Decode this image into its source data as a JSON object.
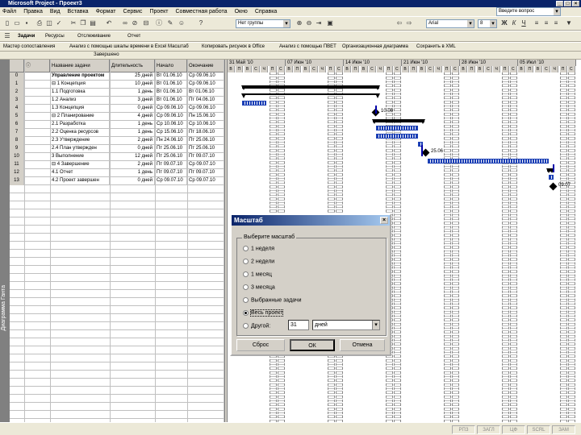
{
  "window": {
    "title": "Microsoft Project - Проект3"
  },
  "menu": [
    "Файл",
    "Правка",
    "Вид",
    "Вставка",
    "Формат",
    "Сервис",
    "Проект",
    "Совместная работа",
    "Окно",
    "Справка"
  ],
  "toolbar": {
    "group_combo": "Нет группы",
    "font_combo": "Arial",
    "size_combo": "8",
    "tasks_label": "Задачи",
    "resources_label": "Ресурсы",
    "track_label": "Отслеживание",
    "report_label": "Отчет",
    "help_box": "Введите вопрос"
  },
  "toolbar3": [
    "Мастер сопоставления",
    "Анализ с помощью шкалы времени в Excel",
    "Масштаб",
    "Копировать рисунок в Office",
    "Анализ с помощью ПВЕТ",
    "Организационная диаграмма",
    "Сохранить в XML"
  ],
  "fieldbar": {
    "value": "Завершено"
  },
  "viewbar": {
    "label": "Диаграмма Ганта"
  },
  "table": {
    "headers": [
      "",
      "",
      "Название задачи",
      "Длительность",
      "Начало",
      "Окончание"
    ],
    "rows": [
      {
        "id": "0",
        "name": "Управление проектом",
        "duration": "25 дней",
        "start": "Вт 01.06.10",
        "finish": "Ср 09.06.10"
      },
      {
        "id": "1",
        "name": "⊟ 1 Концепция",
        "duration": "10 дней",
        "start": "Вт 01.06.10",
        "finish": "Ср 09.06.10"
      },
      {
        "id": "2",
        "name": "1.1 Подготовка",
        "duration": "1 день",
        "start": "Вт 01.06.10",
        "finish": "Вт 01.06.10"
      },
      {
        "id": "3",
        "name": "1.2 Анализ",
        "duration": "3 дней",
        "start": "Вт 01.06.10",
        "finish": "Пт 04.06.10"
      },
      {
        "id": "4",
        "name": "1.3 Концепция",
        "duration": "0 дней",
        "start": "Ср 09.06.10",
        "finish": "Ср 09.06.10"
      },
      {
        "id": "5",
        "name": "⊟ 2 Планирование",
        "duration": "4 дней",
        "start": "Ср 09.06.10",
        "finish": "Пн 15.06.10"
      },
      {
        "id": "6",
        "name": "2.1 Разработка",
        "duration": "1 день",
        "start": "Ср 10.06.10",
        "finish": "Ср 10.06.10"
      },
      {
        "id": "7",
        "name": "2.2 Оценка ресурсов",
        "duration": "1 день",
        "start": "Ср 15.06.10",
        "finish": "Пт 18.06.10"
      },
      {
        "id": "8",
        "name": "2.3 Утверждение",
        "duration": "2 дней",
        "start": "Пн 24.06.10",
        "finish": "Пт 25.06.10"
      },
      {
        "id": "9",
        "name": "2.4 План утвержден",
        "duration": "0 дней",
        "start": "Пт 25.06.10",
        "finish": "Пт 25.06.10"
      },
      {
        "id": "10",
        "name": "3 Выполнение",
        "duration": "12 дней",
        "start": "Пт 25.06.10",
        "finish": "Пт 09.07.10"
      },
      {
        "id": "11",
        "name": "⊟ 4 Завершение",
        "duration": "2 дней",
        "start": "Пт 09.07.10",
        "finish": "Ср 09.07.10"
      },
      {
        "id": "12",
        "name": "4.1 Отчет",
        "duration": "1 день",
        "start": "Пт 09.07.10",
        "finish": "Пт 09.07.10"
      },
      {
        "id": "13",
        "name": "4.2 Проект завершен",
        "duration": "0 дней",
        "start": "Ср 09.07.10",
        "finish": "Ср 09.07.10"
      }
    ]
  },
  "gantt": {
    "weeks": [
      "31 Май '10",
      "07 Июн '10",
      "14 Июн '10",
      "21 Июн '10",
      "28 Июн '10",
      "05 Июл '10"
    ],
    "days": [
      "В",
      "П",
      "В",
      "С",
      "Ч",
      "П",
      "С"
    ],
    "milestones": [
      "10.06",
      "25.06",
      "09.07"
    ]
  },
  "dialog": {
    "title": "Масштаб",
    "group_label": "Выберите масштаб",
    "options": [
      "1 неделя",
      "2 недели",
      "1 месяц",
      "3 месяца",
      "Выбранные задачи",
      "Весь проект",
      "Другой:"
    ],
    "selected_index": 5,
    "custom_value": "31",
    "custom_unit": "дней",
    "reset_button": "Сброс",
    "ok_button": "ОК",
    "cancel_button": "Отмена"
  },
  "status": {
    "indicators": [
      "РПЗ",
      "ЗАГЛ",
      "ЦФ",
      "SCRL",
      "ЗАМ"
    ]
  }
}
